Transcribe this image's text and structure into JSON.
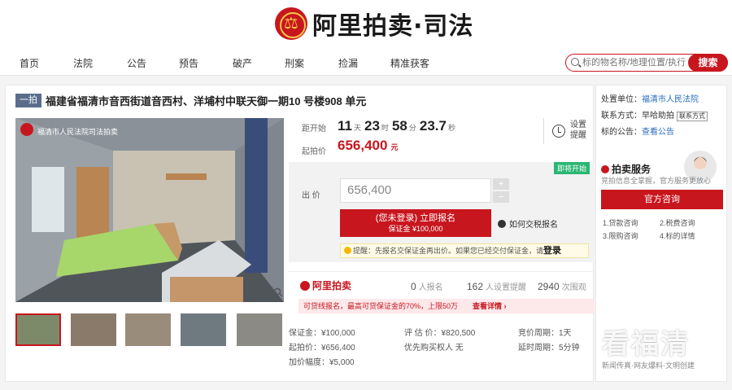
{
  "header": {
    "logo_text": "阿里拍卖·司法",
    "logo_icon": "court-emblem-icon"
  },
  "nav": {
    "items": [
      "首页",
      "法院",
      "公告",
      "预告",
      "破产",
      "刑案",
      "捡漏",
      "精准获客"
    ]
  },
  "search": {
    "placeholder": "标的物名称/地理位置/执行案号",
    "button": "搜索"
  },
  "lot": {
    "tag": "一拍",
    "title": "福建省福清市音西街道音西村、洋埔村中联天御一期10 号楼908 单元",
    "photo_watermark": "福清市人民法院司法拍卖"
  },
  "timer": {
    "label": "距开始",
    "days": "11",
    "days_unit": "天",
    "hours": "23",
    "hours_unit": "时",
    "minutes": "58",
    "minutes_unit": "分",
    "seconds": "23.7",
    "seconds_unit": "秒",
    "remind_label": "设置提醒"
  },
  "start_price": {
    "label": "起拍价",
    "value": "656,400",
    "unit": "元"
  },
  "bid": {
    "status_tag": "即将开始",
    "label": "出  价",
    "value": "656,400",
    "plus": "+",
    "minus": "−",
    "signup_line1": "(您未登录) 立即报名",
    "signup_line2": "保证金 ¥100,000",
    "howto": "如何交税报名",
    "tip_text": "提醒：先报名交保证金再出价。如果您已经交付保证金，请",
    "tip_link": "登录"
  },
  "stats": {
    "brand": "阿里拍卖",
    "signups": "0",
    "signups_label": "人报名",
    "reminders": "162",
    "reminders_label": "人设置提醒",
    "views": "2940",
    "views_label": "次围观"
  },
  "loan": {
    "text": "可贷线报名，最高可贷保证金的70%，上限50万",
    "link": "查看详情 ›"
  },
  "details": {
    "deposit": "保证金：¥100,000",
    "appraisal": "评 估 价：¥820,500",
    "bid_period": "竞价周期：1天",
    "start": "起拍价：¥656,400",
    "priority": "优先购买权人",
    "priority_value": "无",
    "extension": "延时周期：5分钟",
    "increment": "加价幅度：¥5,000"
  },
  "right": {
    "handler_label": "处置单位：",
    "handler": "福清市人民法院",
    "contact_label": "联系方式：",
    "contact": "早哈助拍",
    "contact_btn": "联系方式",
    "notice_label": "标的公告：",
    "notice_link": "查看公告",
    "service_title": "拍卖服务",
    "service_sub": "竞拍信息全掌握，官方服务更放心",
    "consult": "官方咨询",
    "services": [
      "1.贷款咨询",
      "2.税费咨询",
      "3.限购咨询",
      "4.标的详情"
    ]
  },
  "watermark": {
    "text": "看福清",
    "sub": "新闻传真·网友爆料·文明创建"
  },
  "colors": {
    "brand_red": "#c8161e",
    "green": "#2bb673",
    "link_blue": "#2a6cbf"
  }
}
